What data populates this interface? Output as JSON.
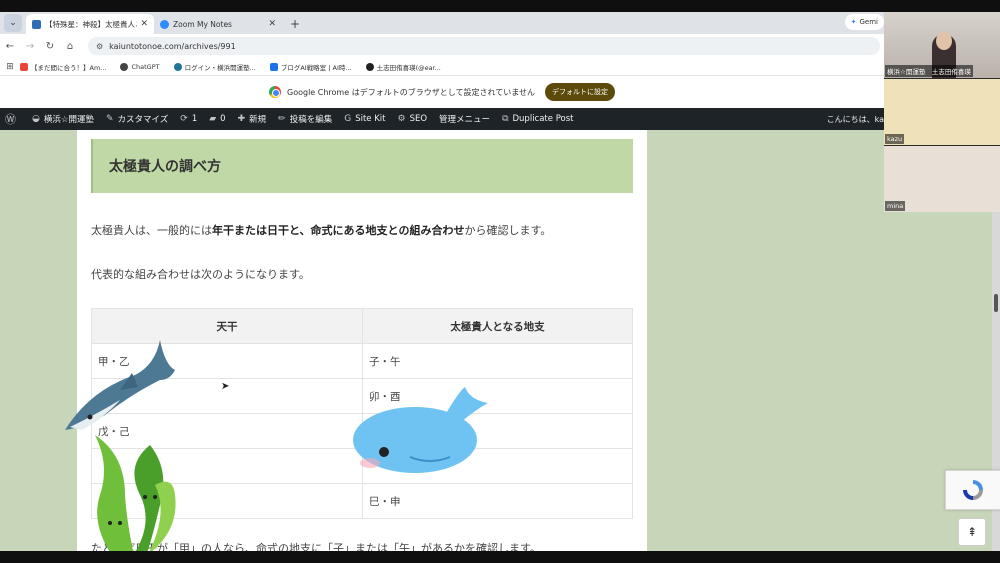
{
  "browser": {
    "tabs": [
      {
        "title": "【特殊星：神殺】太極貴人とは？",
        "active": true,
        "close": "✕"
      },
      {
        "title": "Zoom My Notes",
        "active": false,
        "close": "✕"
      }
    ],
    "new_tab": "+",
    "gemini_label": "Gemi",
    "url": "kaiuntotonoe.com/archives/991",
    "bookmarks": [
      {
        "label": "【まだ間に合う！】Am..."
      },
      {
        "label": "ChatGPT"
      },
      {
        "label": "ログイン・横浜開運塾..."
      },
      {
        "label": "ブログAI戦略室 | AI時..."
      },
      {
        "label": "土志田侑喜瑛(@ear..."
      }
    ],
    "infobar": {
      "message": "Google Chrome はデフォルトのブラウザとして設定されていません",
      "button": "デフォルトに設定"
    }
  },
  "wp_admin": {
    "site_name": "横浜☆開運塾",
    "customize": "カスタマイズ",
    "updates": "1",
    "comments": "0",
    "new": "新規",
    "edit_post": "投稿を編集",
    "site_kit": "Site Kit",
    "seo": "SEO",
    "admin_menu": "管理メニュー",
    "duplicate": "Duplicate Post",
    "greeting": "こんにちは、ka"
  },
  "article": {
    "heading": "太極貴人の調べ方",
    "para1_pre": "太極貴人は、一般的には",
    "para1_bold": "年干または日干と、命式にある地支との組み合わせ",
    "para1_post": "から確認します。",
    "para2": "代表的な組み合わせは次のようになります。",
    "table": {
      "headers": [
        "天干",
        "太極貴人となる地支"
      ],
      "rows": [
        [
          "甲・乙",
          "子・午"
        ],
        [
          "",
          "卯・酉"
        ],
        [
          "戊・己",
          ""
        ],
        [
          "",
          ""
        ],
        [
          "",
          "巳・申"
        ]
      ]
    },
    "bottom_para": "たとえば日干が「甲」の人なら、命式の地支に「子」または「午」があるかを確認します。"
  },
  "zoom": {
    "participants": [
      {
        "label": "横浜☆開運塾　土志田侑喜瑛"
      },
      {
        "label": "kazu"
      },
      {
        "label": "mina"
      }
    ]
  },
  "scroll_to_top": "⇞",
  "colors": {
    "wp_bar": "#1d2327",
    "heading_bg": "#bfd8a6",
    "page_bg": "#c7d6b8",
    "infobar_button": "#5c4a0a"
  }
}
